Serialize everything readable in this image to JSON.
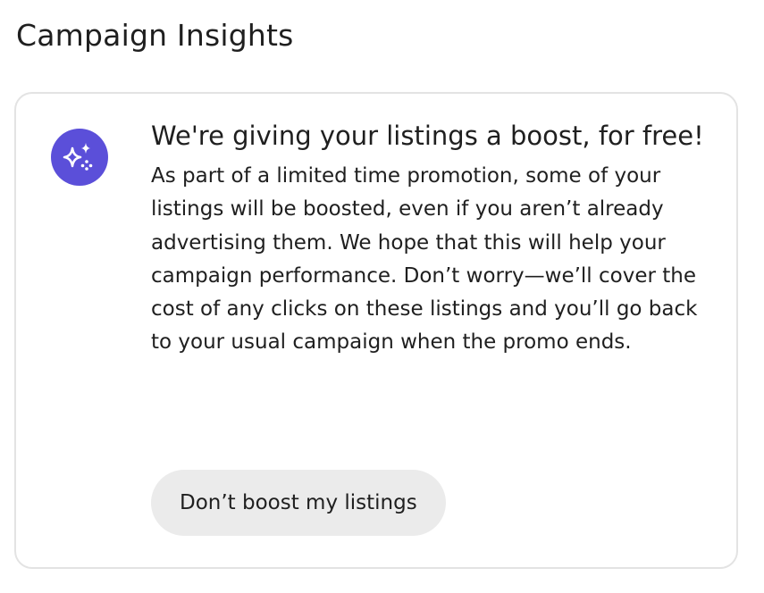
{
  "header": {
    "title": "Campaign Insights"
  },
  "insight_card": {
    "icon": "sparkles-icon",
    "accent_color": "#5b4fd9",
    "headline": "We're giving your listings a boost, for free!",
    "body": "As part of a limited time promotion, some of your listings will be boosted, even if you aren’t already advertising them. We hope that this will help your campaign performance. Don’t worry—we’ll cover the cost of any clicks on these listings and you’ll go back to your usual campaign when the promo ends.",
    "button_label": "Don’t boost my listings"
  }
}
